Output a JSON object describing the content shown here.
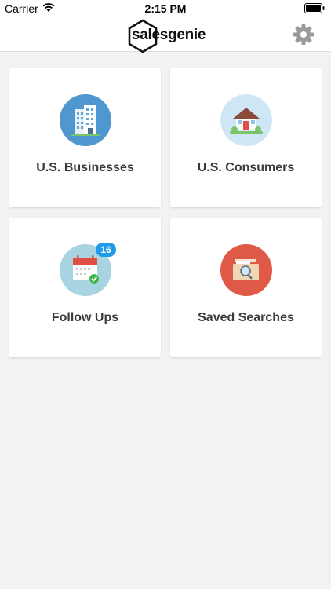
{
  "status_bar": {
    "carrier": "Carrier",
    "time": "2:15 PM",
    "wifi_icon": "wifi-icon",
    "battery_icon": "battery-icon"
  },
  "header": {
    "logo_text": "salesgenie",
    "settings_icon": "gear-icon"
  },
  "tiles": [
    {
      "label": "U.S. Businesses",
      "icon": "office-building-icon",
      "color": "#4f97cf"
    },
    {
      "label": "U.S. Consumers",
      "icon": "house-icon",
      "color": "#cfe6f7"
    },
    {
      "label": "Follow Ups",
      "icon": "calendar-check-icon",
      "color": "#a8d3e0",
      "badge": "16"
    },
    {
      "label": "Saved Searches",
      "icon": "folder-search-icon",
      "color": "#de5a47"
    }
  ],
  "colors": {
    "background": "#f2f2f2",
    "badge": "#1e9be9",
    "card": "#ffffff"
  }
}
